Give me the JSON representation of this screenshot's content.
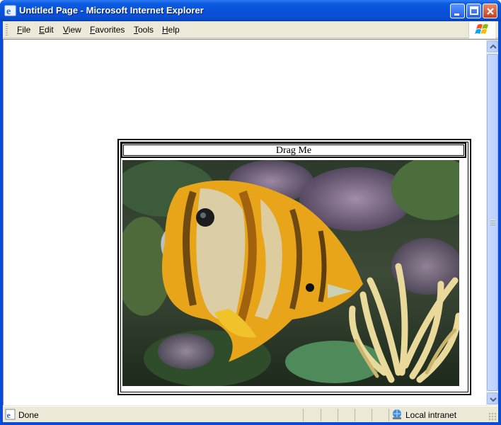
{
  "window": {
    "title": "Untitled Page - Microsoft Internet Explorer"
  },
  "menu": {
    "items": [
      {
        "label_ul": "F",
        "label_rest": "ile"
      },
      {
        "label_ul": "E",
        "label_rest": "dit"
      },
      {
        "label_ul": "V",
        "label_rest": "iew"
      },
      {
        "label_ul": "F",
        "label_rest": "avorites",
        "label_prefix": ""
      },
      {
        "label_ul": "T",
        "label_rest": "ools"
      },
      {
        "label_ul": "H",
        "label_rest": "elp"
      }
    ]
  },
  "page": {
    "drag_label": "Drag Me",
    "image_icon": "butterflyfish-photo"
  },
  "status": {
    "text": "Done",
    "zone": "Local intranet"
  },
  "colors": {
    "titlebar": "#0a4fd4",
    "chrome": "#ece9d8"
  }
}
